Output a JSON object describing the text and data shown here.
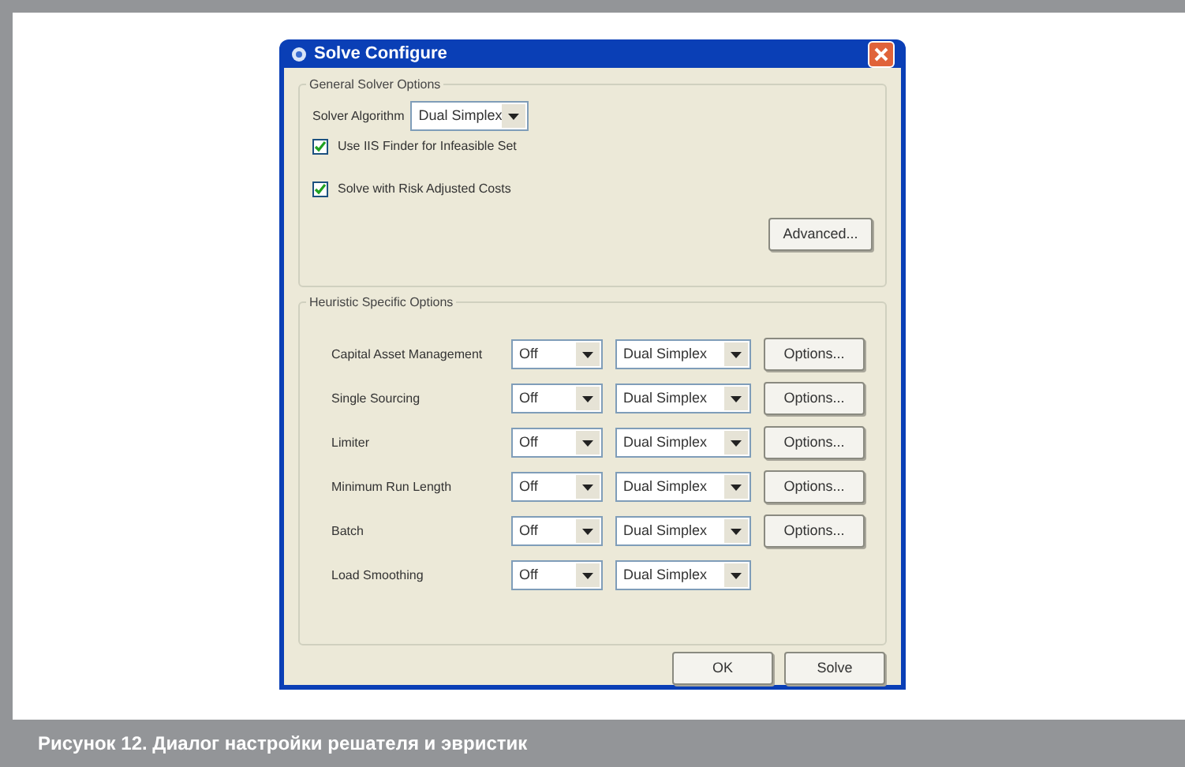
{
  "window": {
    "title": "Solve Configure"
  },
  "general": {
    "title": "General Solver Options",
    "algorithm_label": "Solver Algorithm",
    "algorithm_value": "Dual Simplex",
    "checkboxes": [
      {
        "label": "Use IIS Finder for Infeasible Set",
        "checked": true
      },
      {
        "label": "Solve with Risk Adjusted Costs",
        "checked": true
      }
    ],
    "advanced_button": "Advanced..."
  },
  "heuristics": {
    "title": "Heuristic Specific Options",
    "rows": [
      {
        "label": "Capital Asset Management",
        "mode": "Off",
        "algorithm": "Dual Simplex",
        "options_button": "Options..."
      },
      {
        "label": "Single Sourcing",
        "mode": "Off",
        "algorithm": "Dual Simplex",
        "options_button": "Options..."
      },
      {
        "label": "Limiter",
        "mode": "Off",
        "algorithm": "Dual Simplex",
        "options_button": "Options..."
      },
      {
        "label": "Minimum Run Length",
        "mode": "Off",
        "algorithm": "Dual Simplex",
        "options_button": "Options..."
      },
      {
        "label": "Batch",
        "mode": "Off",
        "algorithm": "Dual Simplex",
        "options_button": "Options..."
      },
      {
        "label": "Load Smoothing",
        "mode": "Off",
        "algorithm": "Dual Simplex"
      }
    ]
  },
  "buttons": [
    "OK",
    "Solve"
  ],
  "caption": "Рисунок 12. Диалог настройки решателя и эвристик"
}
